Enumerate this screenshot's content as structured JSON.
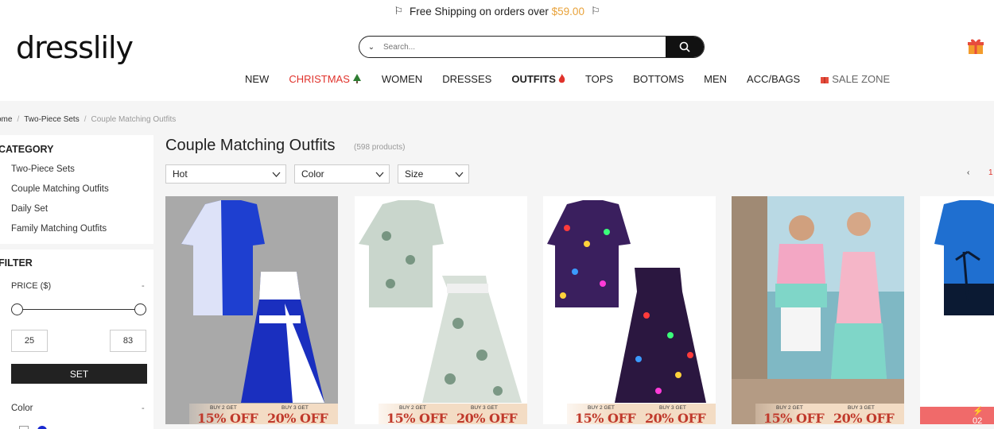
{
  "promo": {
    "text": "Free Shipping on orders over ",
    "amount": "$59.00"
  },
  "logo": "dresslily",
  "search": {
    "placeholder": "Search..."
  },
  "nav": [
    "NEW",
    "CHRISTMAS",
    "WOMEN",
    "DRESSES",
    "OUTFITS",
    "TOPS",
    "BOTTOMS",
    "MEN",
    "ACC/BAGS",
    "SALE ZONE"
  ],
  "breadcrumb": {
    "home": "ome",
    "parent": "Two-Piece Sets",
    "current": "Couple Matching Outfits"
  },
  "sidebar": {
    "category_title": "CATEGORY",
    "categories": [
      "Two-Piece Sets",
      "Couple Matching Outfits",
      "Daily Set",
      "Family Matching Outfits"
    ],
    "filter_title": "FILTER",
    "price_label": "PRICE ($)",
    "collapse": "-",
    "price_min": "25",
    "price_max": "83",
    "set_label": "SET",
    "color_label": "Color"
  },
  "main": {
    "title": "Couple Matching Outfits",
    "count": "(598 products)",
    "sort": "Hot",
    "color": "Color",
    "size": "Size",
    "pager_prev": "‹",
    "pager_page": "1"
  },
  "promo_badge": {
    "small1": "BUY 2 GET",
    "small2": "BUY 3 GET",
    "off1": "15% OFF",
    "off2": "20% OFF"
  },
  "flash_sale": "⚡ 02",
  "colors": {
    "accent": "#e0322b",
    "amount": "#e8a23a",
    "gray_bg": "#f5f5f5"
  },
  "icons": [
    "flag-icon",
    "chevron-down-icon",
    "search-icon",
    "gift-icon",
    "tree-icon",
    "flame-icon"
  ]
}
